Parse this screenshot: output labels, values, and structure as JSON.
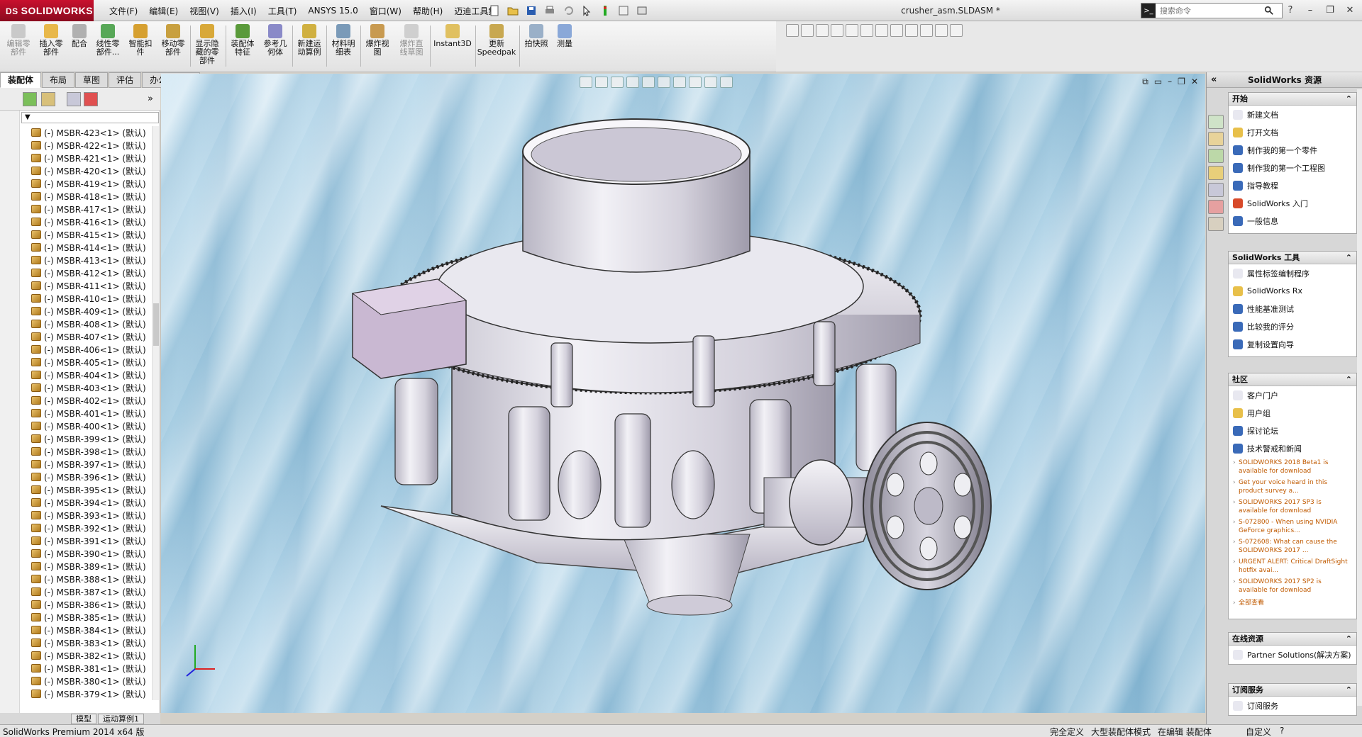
{
  "app": {
    "logo_text": "SOLIDWORKS",
    "doc_title": "crusher_asm.SLDASM *"
  },
  "menu": [
    "文件(F)",
    "编辑(E)",
    "视图(V)",
    "插入(I)",
    "工具(T)",
    "ANSYS 15.0",
    "窗口(W)",
    "帮助(H)",
    "迈迪工具集"
  ],
  "search": {
    "placeholder": "搜索命令"
  },
  "commands": [
    {
      "label": "编辑零\n部件",
      "disabled": true
    },
    {
      "label": "插入零\n部件",
      "disabled": false
    },
    {
      "label": "配合",
      "disabled": false
    },
    {
      "label": "线性零\n部件...",
      "disabled": false
    },
    {
      "label": "智能扣\n件",
      "disabled": false
    },
    {
      "label": "移动零\n部件",
      "disabled": false
    },
    {
      "label": "显示隐\n藏的零\n部件",
      "disabled": false
    },
    {
      "label": "装配体\n特征",
      "disabled": false
    },
    {
      "label": "参考几\n何体",
      "disabled": false
    },
    {
      "label": "新建运\n动算例",
      "disabled": false
    },
    {
      "label": "材料明\n细表",
      "disabled": false
    },
    {
      "label": "爆炸视\n图",
      "disabled": false
    },
    {
      "label": "爆炸直\n线草图",
      "disabled": true
    },
    {
      "label": "Instant3D",
      "disabled": false
    },
    {
      "label": "更新\nSpeedpak",
      "disabled": false
    },
    {
      "label": "拍快照",
      "disabled": false
    },
    {
      "label": "测量",
      "disabled": false
    }
  ],
  "tabs": [
    "装配体",
    "布局",
    "草图",
    "评估",
    "办公室产品"
  ],
  "tree": [
    "(-) MSBR-423<1> (默认)",
    "(-) MSBR-422<1> (默认)",
    "(-) MSBR-421<1> (默认)",
    "(-) MSBR-420<1> (默认)",
    "(-) MSBR-419<1> (默认)",
    "(-) MSBR-418<1> (默认)",
    "(-) MSBR-417<1> (默认)",
    "(-) MSBR-416<1> (默认)",
    "(-) MSBR-415<1> (默认)",
    "(-) MSBR-414<1> (默认)",
    "(-) MSBR-413<1> (默认)",
    "(-) MSBR-412<1> (默认)",
    "(-) MSBR-411<1> (默认)",
    "(-) MSBR-410<1> (默认)",
    "(-) MSBR-409<1> (默认)",
    "(-) MSBR-408<1> (默认)",
    "(-) MSBR-407<1> (默认)",
    "(-) MSBR-406<1> (默认)",
    "(-) MSBR-405<1> (默认)",
    "(-) MSBR-404<1> (默认)",
    "(-) MSBR-403<1> (默认)",
    "(-) MSBR-402<1> (默认)",
    "(-) MSBR-401<1> (默认)",
    "(-) MSBR-400<1> (默认)",
    "(-) MSBR-399<1> (默认)",
    "(-) MSBR-398<1> (默认)",
    "(-) MSBR-397<1> (默认)",
    "(-) MSBR-396<1> (默认)",
    "(-) MSBR-395<1> (默认)",
    "(-) MSBR-394<1> (默认)",
    "(-) MSBR-393<1> (默认)",
    "(-) MSBR-392<1> (默认)",
    "(-) MSBR-391<1> (默认)",
    "(-) MSBR-390<1> (默认)",
    "(-) MSBR-389<1> (默认)",
    "(-) MSBR-388<1> (默认)",
    "(-) MSBR-387<1> (默认)",
    "(-) MSBR-386<1> (默认)",
    "(-) MSBR-385<1> (默认)",
    "(-) MSBR-384<1> (默认)",
    "(-) MSBR-383<1> (默认)",
    "(-) MSBR-382<1> (默认)",
    "(-) MSBR-381<1> (默认)",
    "(-) MSBR-380<1> (默认)",
    "(-) MSBR-379<1> (默认)"
  ],
  "bottom_tabs": [
    "模型",
    "运动算例1"
  ],
  "taskpane": {
    "title": "SolidWorks 资源",
    "start": {
      "title": "开始",
      "items": [
        "新建文档",
        "打开文档",
        "制作我的第一个零件",
        "制作我的第一个工程图",
        "指导教程",
        "SolidWorks 入门",
        "一般信息"
      ]
    },
    "tools": {
      "title": "SolidWorks 工具",
      "items": [
        "属性标签编制程序",
        "SolidWorks Rx",
        "性能基准测试",
        "比较我的评分",
        "复制设置向导"
      ]
    },
    "community": {
      "title": "社区",
      "items": [
        "客户门户",
        "用户组",
        "探讨论坛",
        "技术警戒和新闻"
      ]
    },
    "news": [
      "SOLIDWORKS 2018 Beta1 is available for download",
      "Get your voice heard in this product survey a...",
      "SOLIDWORKS 2017 SP3 is available for download",
      "S-072800 - When using NVIDIA GeForce graphics...",
      "S-072608: What can cause the SOLIDWORKS 2017 ...",
      "URGENT ALERT: Critical DraftSight hotfix avai...",
      "SOLIDWORKS 2017 SP2 is available for download"
    ],
    "news_more": "全部查看",
    "online": {
      "title": "在线资源",
      "items": [
        "Partner Solutions(解决方案)"
      ]
    },
    "subscription": {
      "title": "订阅服务",
      "items": [
        "订阅服务"
      ]
    }
  },
  "status": {
    "left": "SolidWorks Premium 2014 x64 版",
    "right": [
      "完全定义",
      "大型装配体模式",
      "在编辑 装配体"
    ],
    "unit": "自定义"
  },
  "colors": {
    "viewport_bg": "#a9cfe3",
    "logo_red": "#c8102e",
    "metal": "#d9d6e0"
  }
}
